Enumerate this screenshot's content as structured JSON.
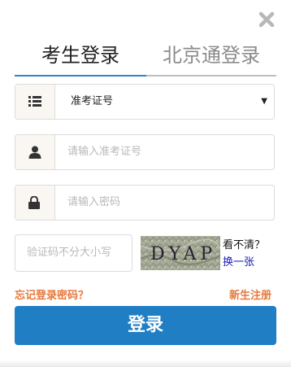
{
  "tabs": {
    "active_label": "考生登录",
    "inactive_label": "北京通登录"
  },
  "form": {
    "login_type": {
      "selected": "准考证号",
      "caret": "▼"
    },
    "username": {
      "placeholder": "请输入准考证号"
    },
    "password": {
      "placeholder": "请输入密码"
    },
    "captcha": {
      "placeholder": "验证码不分大小写",
      "image_text": "DYAP",
      "hint": "看不清？",
      "refresh_label": "换一张"
    }
  },
  "links": {
    "forgot_password": "忘记登录密码？",
    "register": "新生注册"
  },
  "login_button_label": "登录",
  "icons": {
    "close": "close-icon",
    "list": "list-icon",
    "user": "user-icon",
    "lock": "lock-icon"
  },
  "colors": {
    "accent_blue": "#1f7ec4",
    "tab_underline": "#2b86c5",
    "link_orange": "#e8773a",
    "refresh_link": "#1a1ab5"
  }
}
